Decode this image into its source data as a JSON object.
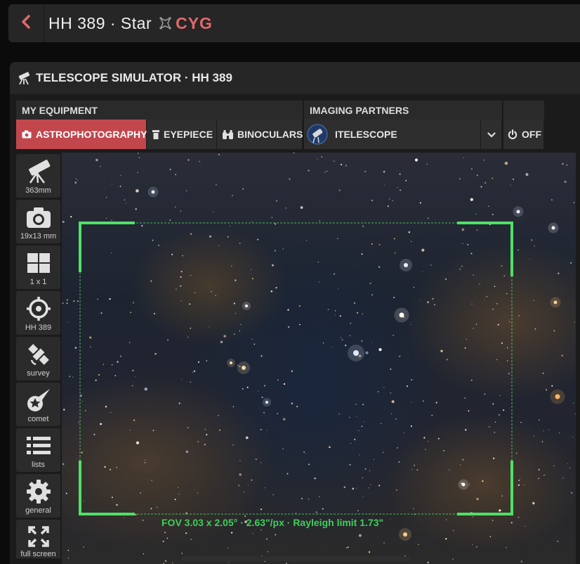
{
  "header": {
    "title": "HH 389 · Star",
    "constellation": "CYG",
    "colors": {
      "accent": "#e2686a"
    }
  },
  "panel": {
    "title": "TELESCOPE SIMULATOR · HH 389",
    "groups": {
      "equipment": "MY EQUIPMENT",
      "partners": "IMAGING PARTNERS"
    },
    "tabs": {
      "astro": "ASTROPHOTOGRAPHY",
      "eyepiece": "EYEPIECE",
      "binoculars": "BINOCULARS",
      "itelescope": "ITELESCOPE",
      "off": "OFF"
    }
  },
  "sidebar": {
    "items": [
      {
        "label": "363mm",
        "icon": "telescope-icon"
      },
      {
        "label": "19x13 mm",
        "icon": "camera-icon"
      },
      {
        "label": "1 x 1",
        "icon": "grid-icon"
      },
      {
        "label": "HH 389",
        "icon": "crosshair-icon"
      },
      {
        "label": "survey",
        "icon": "satellite-icon"
      },
      {
        "label": "comet",
        "icon": "comet-icon"
      },
      {
        "label": "lists",
        "icon": "list-icon"
      },
      {
        "label": "general",
        "icon": "gear-icon"
      },
      {
        "label": "full screen",
        "icon": "expand-icon"
      }
    ]
  },
  "view": {
    "fov": "FOV 3.03 x 2.05° · 2.63\"/px · Rayleigh limit 1.73\"",
    "frame_color": "#4fe067"
  }
}
